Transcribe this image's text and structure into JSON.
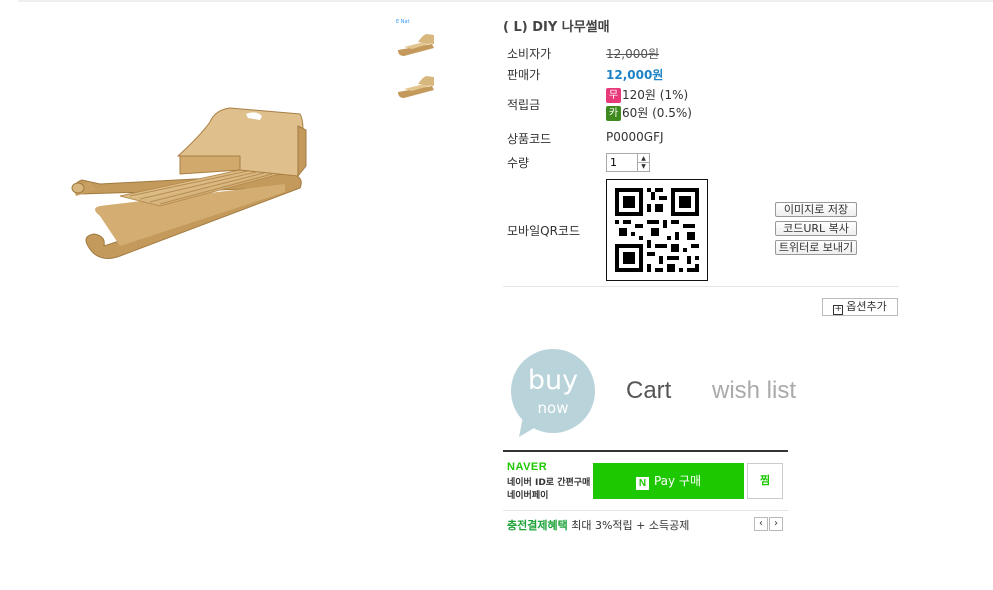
{
  "product": {
    "title": "( L) DIY 나무썰매",
    "thumb_tag": "E Nat"
  },
  "info": {
    "consumer_price_label": "소비자가",
    "consumer_price": "12,000원",
    "sale_price_label": "판매가",
    "sale_price": "12,000원",
    "points_label": "적립금",
    "points": [
      {
        "badge": "무",
        "text": "120원 (1%)"
      },
      {
        "badge": "카",
        "text": "60원 (0.5%)"
      }
    ],
    "code_label": "상품코드",
    "code": "P0000GFJ",
    "qty_label": "수량",
    "qty_value": "1",
    "qr_label": "모바일QR코드",
    "qr_buttons": [
      "이미지로 저장",
      "코드URL 복사",
      "트위터로 보내기"
    ]
  },
  "add_option_label": "옵션추가",
  "actions": {
    "buy_main": "buy",
    "buy_sub": "now",
    "cart": "Cart",
    "wish": "wish list"
  },
  "naver": {
    "logo": "NAVER",
    "desc_line1": "네이버 ID로 간편구매",
    "desc_line2": "네이버페이",
    "pay_label": "Pay 구매",
    "n_icon": "N",
    "jjim": "찜",
    "benefit_highlight": "충전결제혜택",
    "benefit_text": " 최대 3%적립 + 소득공제"
  },
  "colors": {
    "price_blue": "#1e83c6",
    "naver_green": "#1ec800",
    "buy_bubble": "#b8d3d9"
  }
}
